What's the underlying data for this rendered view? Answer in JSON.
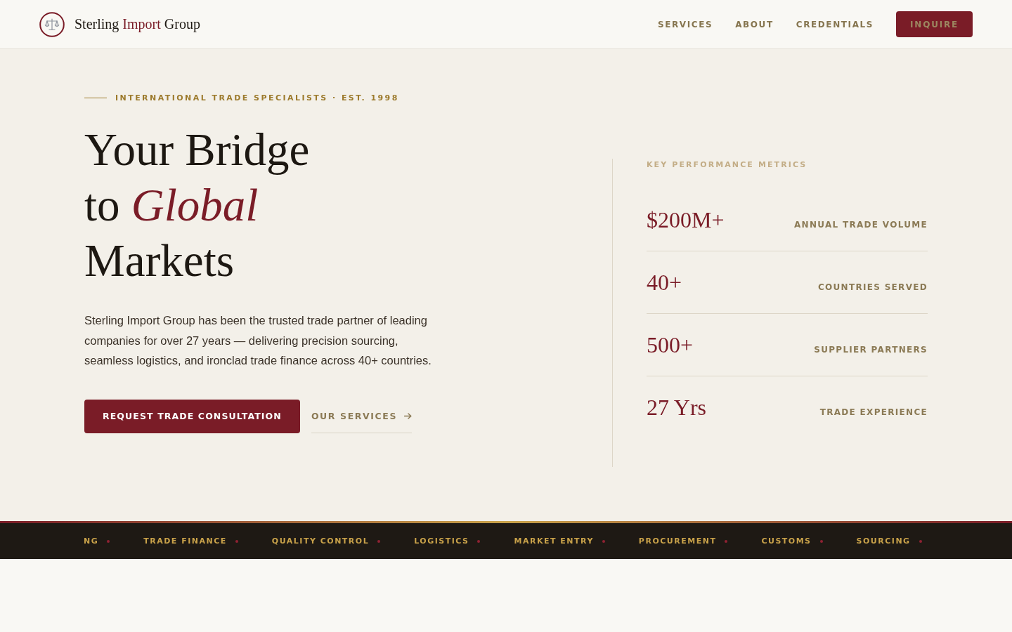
{
  "header": {
    "brand": {
      "name_start": "Sterling",
      "name_highlight": "Import",
      "name_end": "Group"
    },
    "nav": [
      {
        "label": "SERVICES"
      },
      {
        "label": "ABOUT"
      },
      {
        "label": "CREDENTIALS"
      }
    ],
    "cta": {
      "label": "INQUIRE"
    }
  },
  "hero": {
    "eyebrow": "INTERNATIONAL TRADE SPECIALISTS · EST. 1998",
    "heading": "Your Bridge\nto *Global*\nMarkets",
    "body": "Sterling Import Group has been the trusted trade partner of leading companies for over 27 years — delivering precision sourcing, seamless logistics, and ironclad trade finance across 40+ countries.",
    "actions": [
      {
        "kind": "primary",
        "label": "REQUEST TRADE CONSULTATION"
      },
      {
        "kind": "link",
        "label": "OUR SERVICES"
      }
    ]
  },
  "metrics": {
    "title": "KEY PERFORMANCE METRICS",
    "items": [
      {
        "value": "$200M+",
        "label": "ANNUAL TRADE VOLUME"
      },
      {
        "value": "40+",
        "label": "COUNTRIES SERVED"
      },
      {
        "value": "500+",
        "label": "SUPPLIER PARTNERS"
      },
      {
        "value": "27 Yrs",
        "label": "TRADE EXPERIENCE"
      }
    ]
  },
  "ticker": {
    "items": [
      {
        "label": "NG"
      },
      {
        "label": "TRADE FINANCE"
      },
      {
        "label": "QUALITY CONTROL"
      },
      {
        "label": "LOGISTICS"
      },
      {
        "label": "MARKET ENTRY"
      },
      {
        "label": "PROCUREMENT"
      },
      {
        "label": "CUSTOMS"
      },
      {
        "label": "SOURCING"
      }
    ]
  }
}
